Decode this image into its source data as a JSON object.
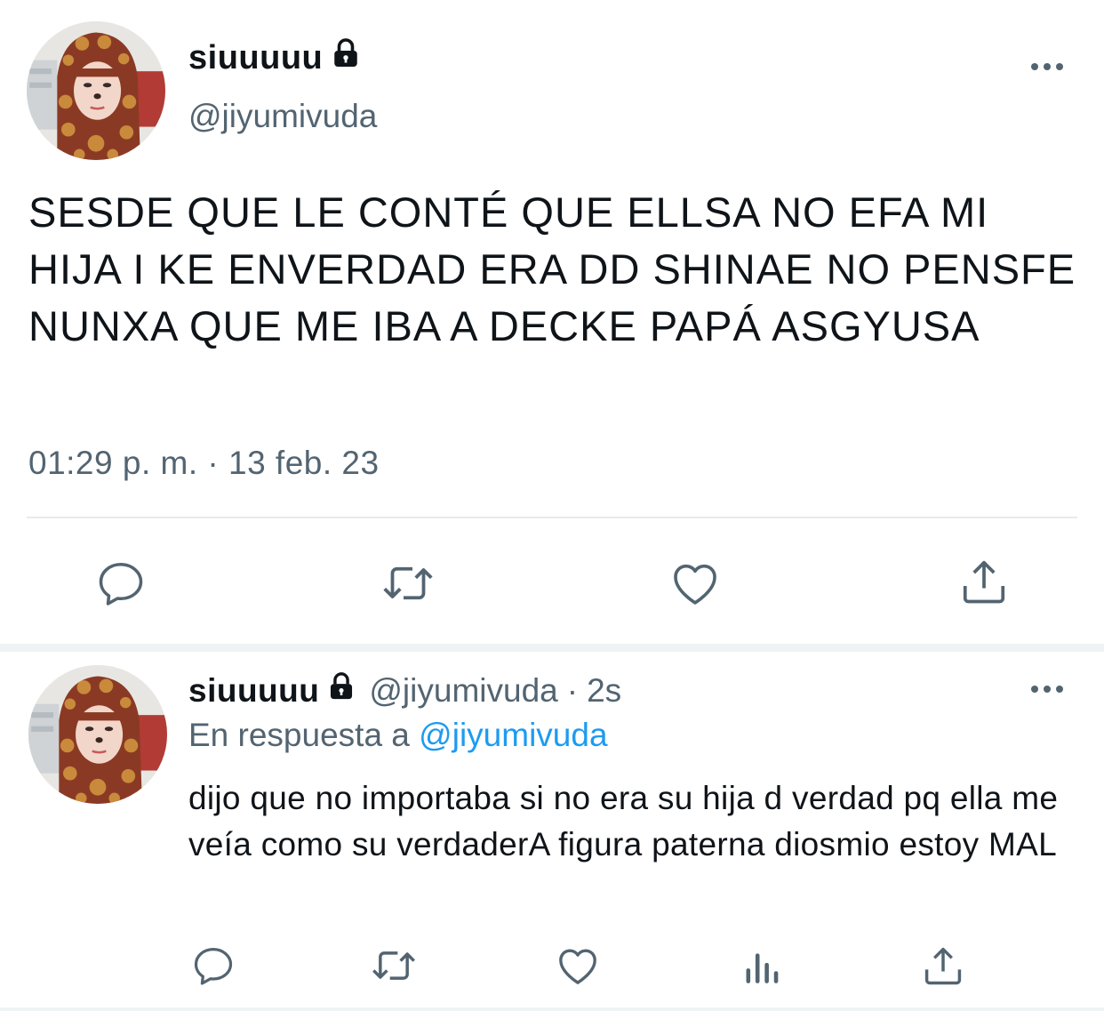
{
  "main_tweet": {
    "display_name": "siuuuuu",
    "handle": "@jiyumivuda",
    "text": "SESDE QUE LE CONTÉ QUE ELLSA NO EFA MI HIJA I KE ENVERDAD ERA DD SHINAE NO PENSFE NUNXA QUE ME IBA A DECKE PAPÁ ASGYUSA",
    "timestamp": "01:29 p. m. · 13 feb. 23",
    "actions": [
      "reply-icon",
      "retweet-icon",
      "like-icon",
      "share-icon"
    ]
  },
  "reply_tweet": {
    "display_name": "siuuuuu",
    "handle": "@jiyumivuda",
    "separator": "·",
    "time": "2s",
    "reply_prefix": "En respuesta a",
    "reply_mention": "@jiyumivuda",
    "text": "dijo que no importaba si no era su hija d verdad pq ella me veía como su verdaderA figura paterna diosmio estoy MAL",
    "actions": [
      "reply-icon",
      "retweet-icon",
      "like-icon",
      "analytics-icon",
      "share-icon"
    ]
  },
  "colors": {
    "text": "#0f1419",
    "secondary": "#536471",
    "link": "#1d9bf0",
    "divider": "#eff3f4"
  }
}
